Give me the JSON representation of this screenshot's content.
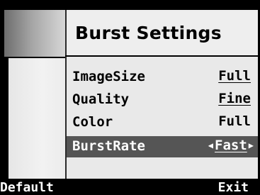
{
  "title": "Burst Settings",
  "settings": [
    {
      "label": "ImageSize",
      "value": "Full"
    },
    {
      "label": "Quality",
      "value": "Fine"
    },
    {
      "label": "Color",
      "value": "Full"
    },
    {
      "label": "BurstRate",
      "value": "Fast"
    }
  ],
  "softkeys": {
    "left": "Default",
    "right": "Exit"
  },
  "icons": {
    "prev": "left-arrow",
    "next": "right-arrow"
  }
}
